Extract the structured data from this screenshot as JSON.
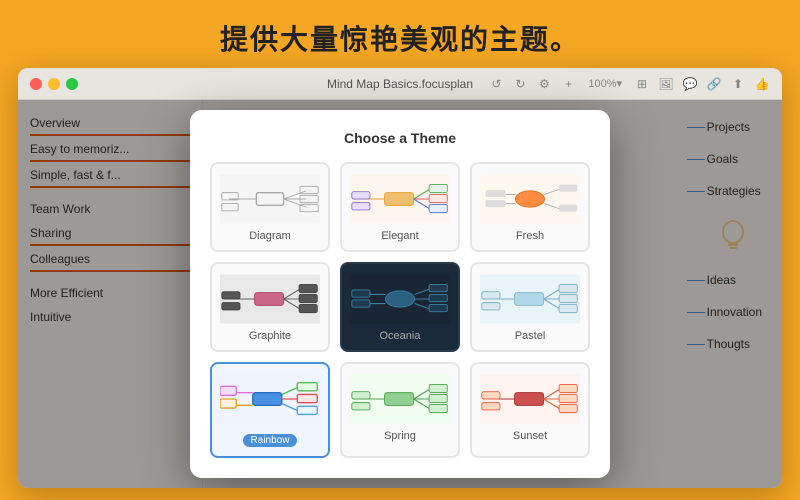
{
  "page": {
    "title": "提供大量惊艳美观的主题。",
    "titlebar": {
      "filename": "Mind Map Basics.focusplan"
    }
  },
  "dialog": {
    "title": "Choose a Theme",
    "themes": [
      {
        "id": "diagram",
        "label": "Diagram",
        "selected": false
      },
      {
        "id": "elegant",
        "label": "Elegant",
        "selected": false
      },
      {
        "id": "fresh",
        "label": "Fresh",
        "selected": false
      },
      {
        "id": "graphite",
        "label": "Graphite",
        "selected": false
      },
      {
        "id": "oceania",
        "label": "Oceania",
        "selected": false
      },
      {
        "id": "pastel",
        "label": "Pastel",
        "selected": false
      },
      {
        "id": "rainbow",
        "label": "Rainbow",
        "selected": true,
        "badge": "Rainbow"
      },
      {
        "id": "spring",
        "label": "Spring",
        "selected": false
      },
      {
        "id": "sunset",
        "label": "Sunset",
        "selected": false
      }
    ]
  },
  "left_panel": {
    "items": [
      {
        "text": "Overview",
        "has_line": true
      },
      {
        "text": "Easy to memoriz...",
        "has_line": true
      },
      {
        "text": "Simple, fast & f...",
        "has_line": true
      },
      {
        "text": "Team Work",
        "has_line": false
      },
      {
        "text": "Sharing",
        "has_line": true
      },
      {
        "text": "Colleagues",
        "has_line": true
      },
      {
        "text": "More Efficient",
        "has_line": false
      },
      {
        "text": "Intuitive",
        "has_line": false
      }
    ]
  },
  "right_panel": {
    "items": [
      {
        "text": "Projects"
      },
      {
        "text": "Goals"
      },
      {
        "text": "Strategies"
      },
      {
        "text": "Ideas"
      },
      {
        "text": "Innovation"
      },
      {
        "text": "Thougts"
      }
    ]
  },
  "colors": {
    "accent_orange": "#f5a623",
    "blue": "#4a90d9",
    "dot_red": "#ff5f57",
    "dot_yellow": "#febc2e",
    "dot_green": "#28c840"
  }
}
